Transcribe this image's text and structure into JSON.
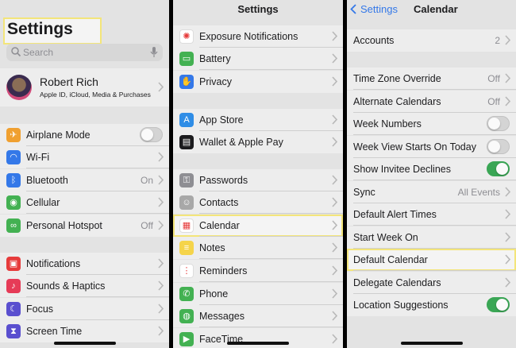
{
  "left_panel": {
    "title": "Settings",
    "search_placeholder": "Search",
    "profile": {
      "name": "Robert Rich",
      "subtitle": "Apple ID, iCloud, Media & Purchases"
    },
    "items": [
      {
        "label": "Airplane Mode",
        "icon": "airplane-icon",
        "color": "#f0a030",
        "value": ""
      },
      {
        "label": "Wi-Fi",
        "icon": "wifi-icon",
        "color": "#3478e8",
        "value": ""
      },
      {
        "label": "Bluetooth",
        "icon": "bluetooth-icon",
        "color": "#3478e8",
        "value": "On"
      },
      {
        "label": "Cellular",
        "icon": "cellular-icon",
        "color": "#43b152",
        "value": ""
      },
      {
        "label": "Personal Hotspot",
        "icon": "hotspot-icon",
        "color": "#43b152",
        "value": "Off"
      },
      {
        "label": "Notifications",
        "icon": "notifications-icon",
        "color": "#e63b3b",
        "value": ""
      },
      {
        "label": "Sounds & Haptics",
        "icon": "sounds-icon",
        "color": "#e63b57",
        "value": ""
      },
      {
        "label": "Focus",
        "icon": "focus-moon-icon",
        "color": "#5a4fcf",
        "value": ""
      },
      {
        "label": "Screen Time",
        "icon": "hourglass-icon",
        "color": "#5a4fcf",
        "value": ""
      }
    ]
  },
  "middle_panel": {
    "title": "Settings",
    "items": [
      {
        "label": "Exposure Notifications",
        "icon": "exposure-icon",
        "color": "#ffffff"
      },
      {
        "label": "Battery",
        "icon": "battery-icon",
        "color": "#43b152"
      },
      {
        "label": "Privacy",
        "icon": "hand-icon",
        "color": "#3478e8"
      },
      {
        "label": "App Store",
        "icon": "appstore-icon",
        "color": "#2f8de6"
      },
      {
        "label": "Wallet & Apple Pay",
        "icon": "wallet-icon",
        "color": "#1c1c1e"
      },
      {
        "label": "Passwords",
        "icon": "key-icon",
        "color": "#8e8e93"
      },
      {
        "label": "Contacts",
        "icon": "contacts-icon",
        "color": "#a8a8a8"
      },
      {
        "label": "Calendar",
        "icon": "calendar-icon",
        "color": "#ffffff"
      },
      {
        "label": "Notes",
        "icon": "notes-icon",
        "color": "#f5d44a"
      },
      {
        "label": "Reminders",
        "icon": "reminders-icon",
        "color": "#ffffff"
      },
      {
        "label": "Phone",
        "icon": "phone-icon",
        "color": "#43b152"
      },
      {
        "label": "Messages",
        "icon": "messages-icon",
        "color": "#43b152"
      },
      {
        "label": "FaceTime",
        "icon": "facetime-icon",
        "color": "#43b152"
      }
    ]
  },
  "right_panel": {
    "back_label": "Settings",
    "title": "Calendar",
    "accounts": {
      "label": "Accounts",
      "value": "2"
    },
    "items": [
      {
        "label": "Time Zone Override",
        "value": "Off"
      },
      {
        "label": "Alternate Calendars",
        "value": "Off"
      },
      {
        "label": "Week Numbers",
        "value": ""
      },
      {
        "label": "Week View Starts On Today",
        "value": ""
      },
      {
        "label": "Show Invitee Declines",
        "value": ""
      },
      {
        "label": "Sync",
        "value": "All Events"
      },
      {
        "label": "Default Alert Times",
        "value": ""
      },
      {
        "label": "Start Week On",
        "value": ""
      },
      {
        "label": "Default Calendar",
        "value": ""
      },
      {
        "label": "Delegate Calendars",
        "value": ""
      },
      {
        "label": "Location Suggestions",
        "value": ""
      }
    ]
  },
  "colors": {
    "highlight": "#f3e57a",
    "toggle_on": "#3aa655",
    "link": "#3478e8"
  }
}
